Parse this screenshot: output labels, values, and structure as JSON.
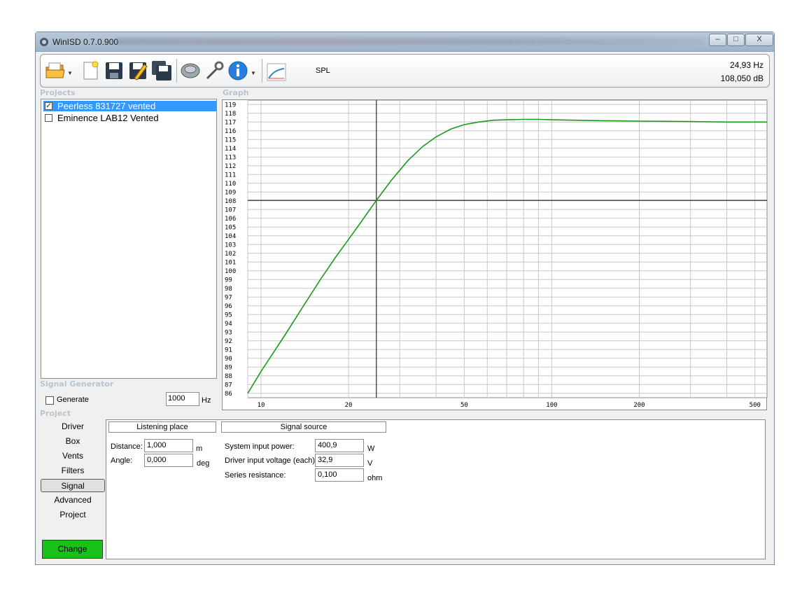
{
  "window": {
    "title": "WinISD 0.7.0.900",
    "controls": {
      "minimize": "–",
      "maximize": "□",
      "close": "X"
    }
  },
  "toolbar": {
    "icons": [
      "open-folder-icon",
      "new-project-icon",
      "save-icon",
      "edit-icon",
      "save-all-icon",
      "driver-icon",
      "tools-icon",
      "info-icon",
      "spl-graph-icon"
    ],
    "graph_type_label": "SPL",
    "cursor_frequency": "24,93 Hz",
    "cursor_level": "108,050 dB"
  },
  "projects": {
    "section_label": "Projects",
    "items": [
      {
        "name": "Peerless 831727 vented",
        "checked": true,
        "selected": true
      },
      {
        "name": "Eminence LAB12 Vented",
        "checked": false,
        "selected": false
      }
    ]
  },
  "signal_generator": {
    "section_label": "Signal Generator",
    "generate_label": "Generate",
    "frequency_value": "1000",
    "frequency_unit": "Hz"
  },
  "graph": {
    "section_label": "Graph"
  },
  "chart_data": {
    "type": "line",
    "title": "",
    "xlabel": "",
    "ylabel": "",
    "x_scale": "log",
    "xlim": [
      9,
      550
    ],
    "ylim": [
      85.5,
      119.5
    ],
    "x_tick_labels": [
      "10",
      "20",
      "50",
      "100",
      "200",
      "500"
    ],
    "y_tick_labels": [
      "119",
      "118",
      "117",
      "116",
      "115",
      "114",
      "113",
      "112",
      "111",
      "110",
      "109",
      "108",
      "107",
      "106",
      "105",
      "104",
      "103",
      "102",
      "101",
      "100",
      "99",
      "98",
      "97",
      "96",
      "95",
      "94",
      "93",
      "92",
      "91",
      "90",
      "89",
      "88",
      "87",
      "86"
    ],
    "grid": true,
    "cursor": {
      "x": 24.93,
      "y": 108.05
    },
    "series": [
      {
        "color": "#1a9a1a",
        "x": [
          9,
          10,
          12,
          14,
          16,
          18,
          20,
          22,
          24.93,
          28,
          32,
          36,
          40,
          45,
          50,
          56,
          63,
          70,
          80,
          90,
          100,
          120,
          150,
          200,
          300,
          400,
          550
        ],
        "y": [
          86.0,
          88.5,
          92.5,
          96.0,
          99.0,
          101.5,
          103.6,
          105.5,
          108.05,
          110.3,
          112.6,
          114.2,
          115.3,
          116.2,
          116.7,
          117.0,
          117.2,
          117.25,
          117.3,
          117.3,
          117.25,
          117.2,
          117.15,
          117.1,
          117.05,
          117.0,
          117.0
        ]
      }
    ]
  },
  "project_section": {
    "section_label": "Project",
    "nav": [
      "Driver",
      "Box",
      "Vents",
      "Filters",
      "Signal",
      "Advanced",
      "Project"
    ],
    "active_nav": "Signal",
    "change_label": "Change"
  },
  "listening_place": {
    "header": "Listening place",
    "distance_label": "Distance:",
    "distance_value": "1,000",
    "distance_unit": "m",
    "angle_label": "Angle:",
    "angle_value": "0,000",
    "angle_unit": "deg"
  },
  "signal_source": {
    "header": "Signal source",
    "power_label": "System input power:",
    "power_value": "400,9",
    "power_unit": "W",
    "voltage_label": "Driver input voltage (each):",
    "voltage_value": "32,9",
    "voltage_unit": "V",
    "resistance_label": "Series resistance:",
    "resistance_value": "0,100",
    "resistance_unit": "ohm"
  }
}
